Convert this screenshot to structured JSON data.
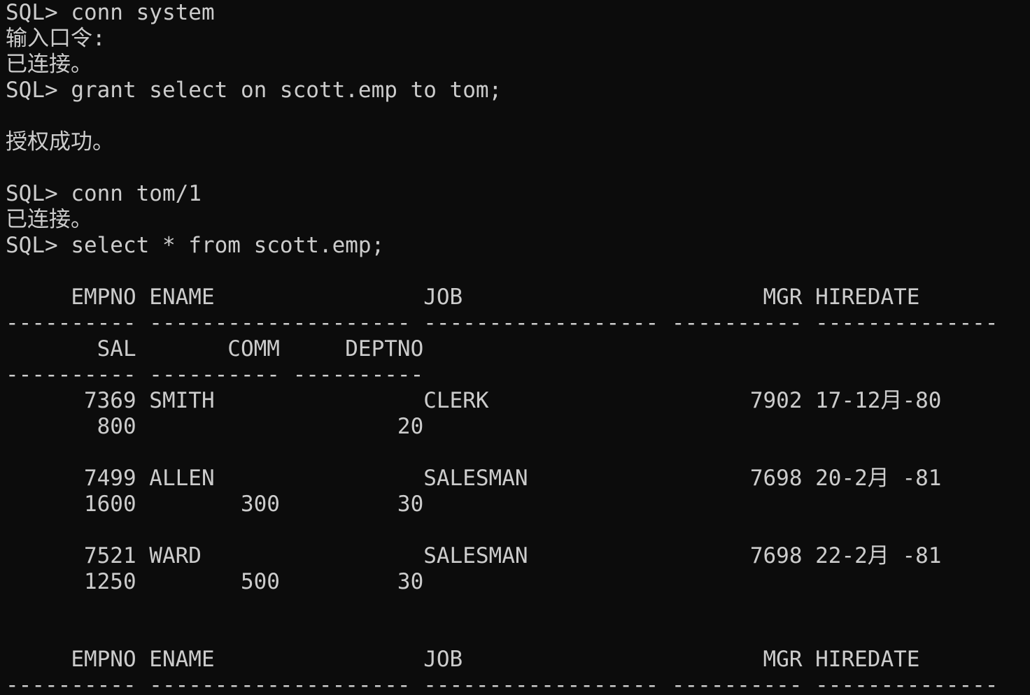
{
  "window": {
    "background": "#0c0c0c",
    "foreground": "#cccccc"
  },
  "session": [
    "SQL> conn system",
    "输入口令:",
    "已连接。",
    "SQL> grant select on scott.emp to tom;",
    "",
    "授权成功。",
    "",
    "SQL> conn tom/1",
    "已连接。",
    "SQL> select * from scott.emp;",
    "",
    "     EMPNO ENAME                JOB                       MGR HIREDATE",
    "---------- -------------------- ------------------ ---------- --------------",
    "       SAL       COMM     DEPTNO",
    "---------- ---------- ----------",
    "      7369 SMITH                CLERK                    7902 17-12月-80",
    "       800                    20",
    "",
    "      7499 ALLEN                SALESMAN                 7698 20-2月 -81",
    "      1600        300         30",
    "",
    "      7521 WARD                 SALESMAN                 7698 22-2月 -81",
    "      1250        500         30",
    "",
    "",
    "     EMPNO ENAME                JOB                       MGR HIREDATE",
    "---------- -------------------- ------------------ ---------- --------------"
  ]
}
